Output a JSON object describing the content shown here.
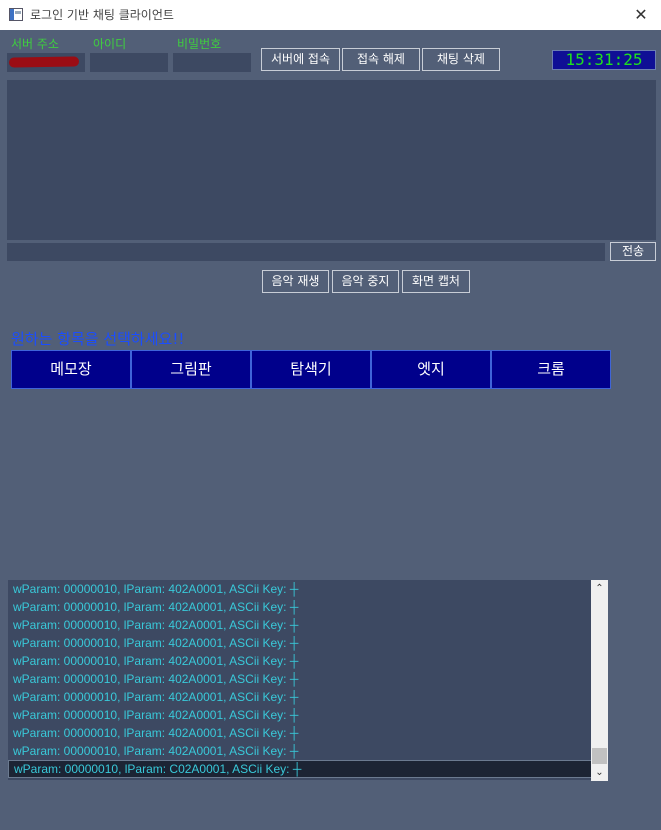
{
  "window": {
    "title": "로그인 기반 채팅 클라이언트",
    "close_glyph": "✕"
  },
  "login": {
    "server_label": "서버 주소",
    "id_label": "아이디",
    "password_label": "비밀번호"
  },
  "toolbar": {
    "connect_label": "서버에 접속",
    "disconnect_label": "접속 해제",
    "clear_chat_label": "채팅 삭제"
  },
  "clock": "15:31:25",
  "chat": {
    "send_label": "전송"
  },
  "media": {
    "play_label": "음악 재생",
    "stop_label": "음악 중지",
    "capture_label": "화면 캡처"
  },
  "launcher": {
    "prompt": "원하는 항목을 선택하세요!!",
    "apps": [
      "메모장",
      "그림판",
      "탐색기",
      "엣지",
      "크롬"
    ]
  },
  "log": {
    "lines": [
      "wParam: 00000010, lParam: 402A0001, ASCii Key: ┼",
      "wParam: 00000010, lParam: 402A0001, ASCii Key: ┼",
      "wParam: 00000010, lParam: 402A0001, ASCii Key: ┼",
      "wParam: 00000010, lParam: 402A0001, ASCii Key: ┼",
      "wParam: 00000010, lParam: 402A0001, ASCii Key: ┼",
      "wParam: 00000010, lParam: 402A0001, ASCii Key: ┼",
      "wParam: 00000010, lParam: 402A0001, ASCii Key: ┼",
      "wParam: 00000010, lParam: 402A0001, ASCii Key: ┼",
      "wParam: 00000010, lParam: 402A0001, ASCii Key: ┼",
      "wParam: 00000010, lParam: 402A0001, ASCii Key: ┼",
      "wParam: 00000010, lParam: C02A0001, ASCii Key: ┼"
    ],
    "selected_index": 10
  },
  "scrollbar": {
    "up_glyph": "⌃",
    "down_glyph": "⌄"
  },
  "colors": {
    "background": "#525f77",
    "field": "#3d4962",
    "label_green": "#3fcf3f",
    "prompt_blue": "#1b4dff",
    "tile_navy": "#00008b",
    "clock_text": "#1fe01f",
    "log_text": "#39c9d9"
  }
}
